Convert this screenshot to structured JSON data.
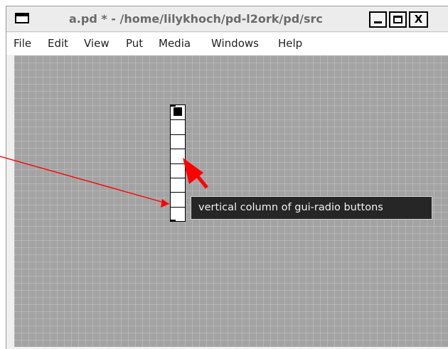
{
  "window": {
    "title": "a.pd * - /home/lilykhoch/pd-l2ork/pd/src",
    "buttons": {
      "minimize": "_",
      "maximize": "□",
      "close": "X"
    }
  },
  "menubar": {
    "items": [
      "File",
      "Edit",
      "View",
      "Put",
      "Media",
      "Windows",
      "Help"
    ]
  },
  "canvas": {
    "radio": {
      "orientation": "vertical",
      "cells": 8,
      "selected_index": 0
    }
  },
  "annotation": {
    "tooltip": "vertical column of gui-radio buttons",
    "arrow_color": "#ff0000"
  },
  "colors": {
    "canvas_bg": "#a3a3a3",
    "tooltip_bg": "#262626",
    "annotation": "#ff0000"
  }
}
